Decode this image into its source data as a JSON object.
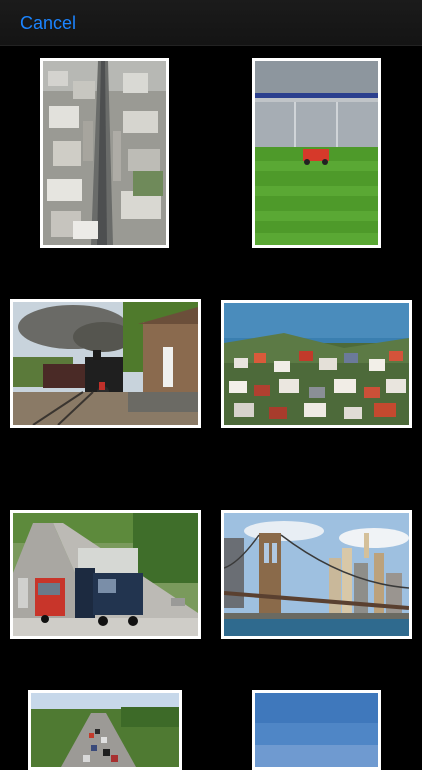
{
  "nav": {
    "cancel_label": "Cancel"
  },
  "colors": {
    "accent": "#1b84ff",
    "background": "#000000",
    "nav_background": "#171717"
  },
  "photos": [
    {
      "subject": "aerial-city-street-photo"
    },
    {
      "subject": "stadium-field-photo"
    },
    {
      "subject": "steam-train-station-photo"
    },
    {
      "subject": "coastal-houses-photo"
    },
    {
      "subject": "highway-trucks-photo"
    },
    {
      "subject": "bridge-skyline-photo"
    },
    {
      "subject": "highway-traffic-photo"
    },
    {
      "subject": "sky-photo"
    }
  ]
}
